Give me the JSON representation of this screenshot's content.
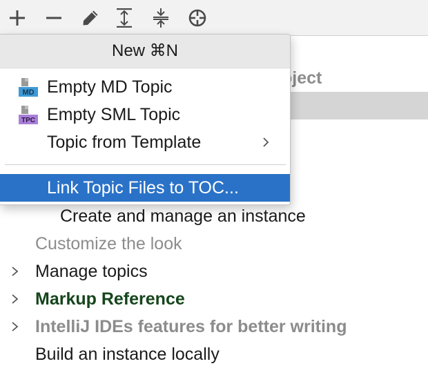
{
  "toolbar": {
    "buttons": [
      {
        "name": "add-icon"
      },
      {
        "name": "remove-icon"
      },
      {
        "name": "edit-icon"
      },
      {
        "name": "expand-all-icon"
      },
      {
        "name": "collapse-all-icon"
      },
      {
        "name": "locate-icon"
      }
    ]
  },
  "tree": {
    "partial_label": "oject",
    "rows": [
      {
        "label": "Create and manage an instance"
      },
      {
        "label": "Customize the look"
      },
      {
        "label": "Manage topics"
      },
      {
        "label": "Markup Reference"
      },
      {
        "label": "IntelliJ IDEs features for better writing"
      },
      {
        "label": "Build an instance locally"
      }
    ]
  },
  "popup": {
    "header": "New ⌘N",
    "items": [
      {
        "label": "Empty MD Topic",
        "icon": "md-file-icon",
        "badge": "MD",
        "badge_color": "#3d9ad6"
      },
      {
        "label": "Empty SML Topic",
        "icon": "tpc-file-icon",
        "badge": "TPC",
        "badge_color": "#a97fd8"
      },
      {
        "label": "Topic from Template",
        "has_submenu": true
      }
    ],
    "highlighted_item": {
      "label": "Link Topic Files to TOC..."
    }
  },
  "colors": {
    "selection": "#2a72c7",
    "tree_selection": "#d5d5d5",
    "green_text": "#15451c",
    "muted_text": "#8c8c8c"
  }
}
